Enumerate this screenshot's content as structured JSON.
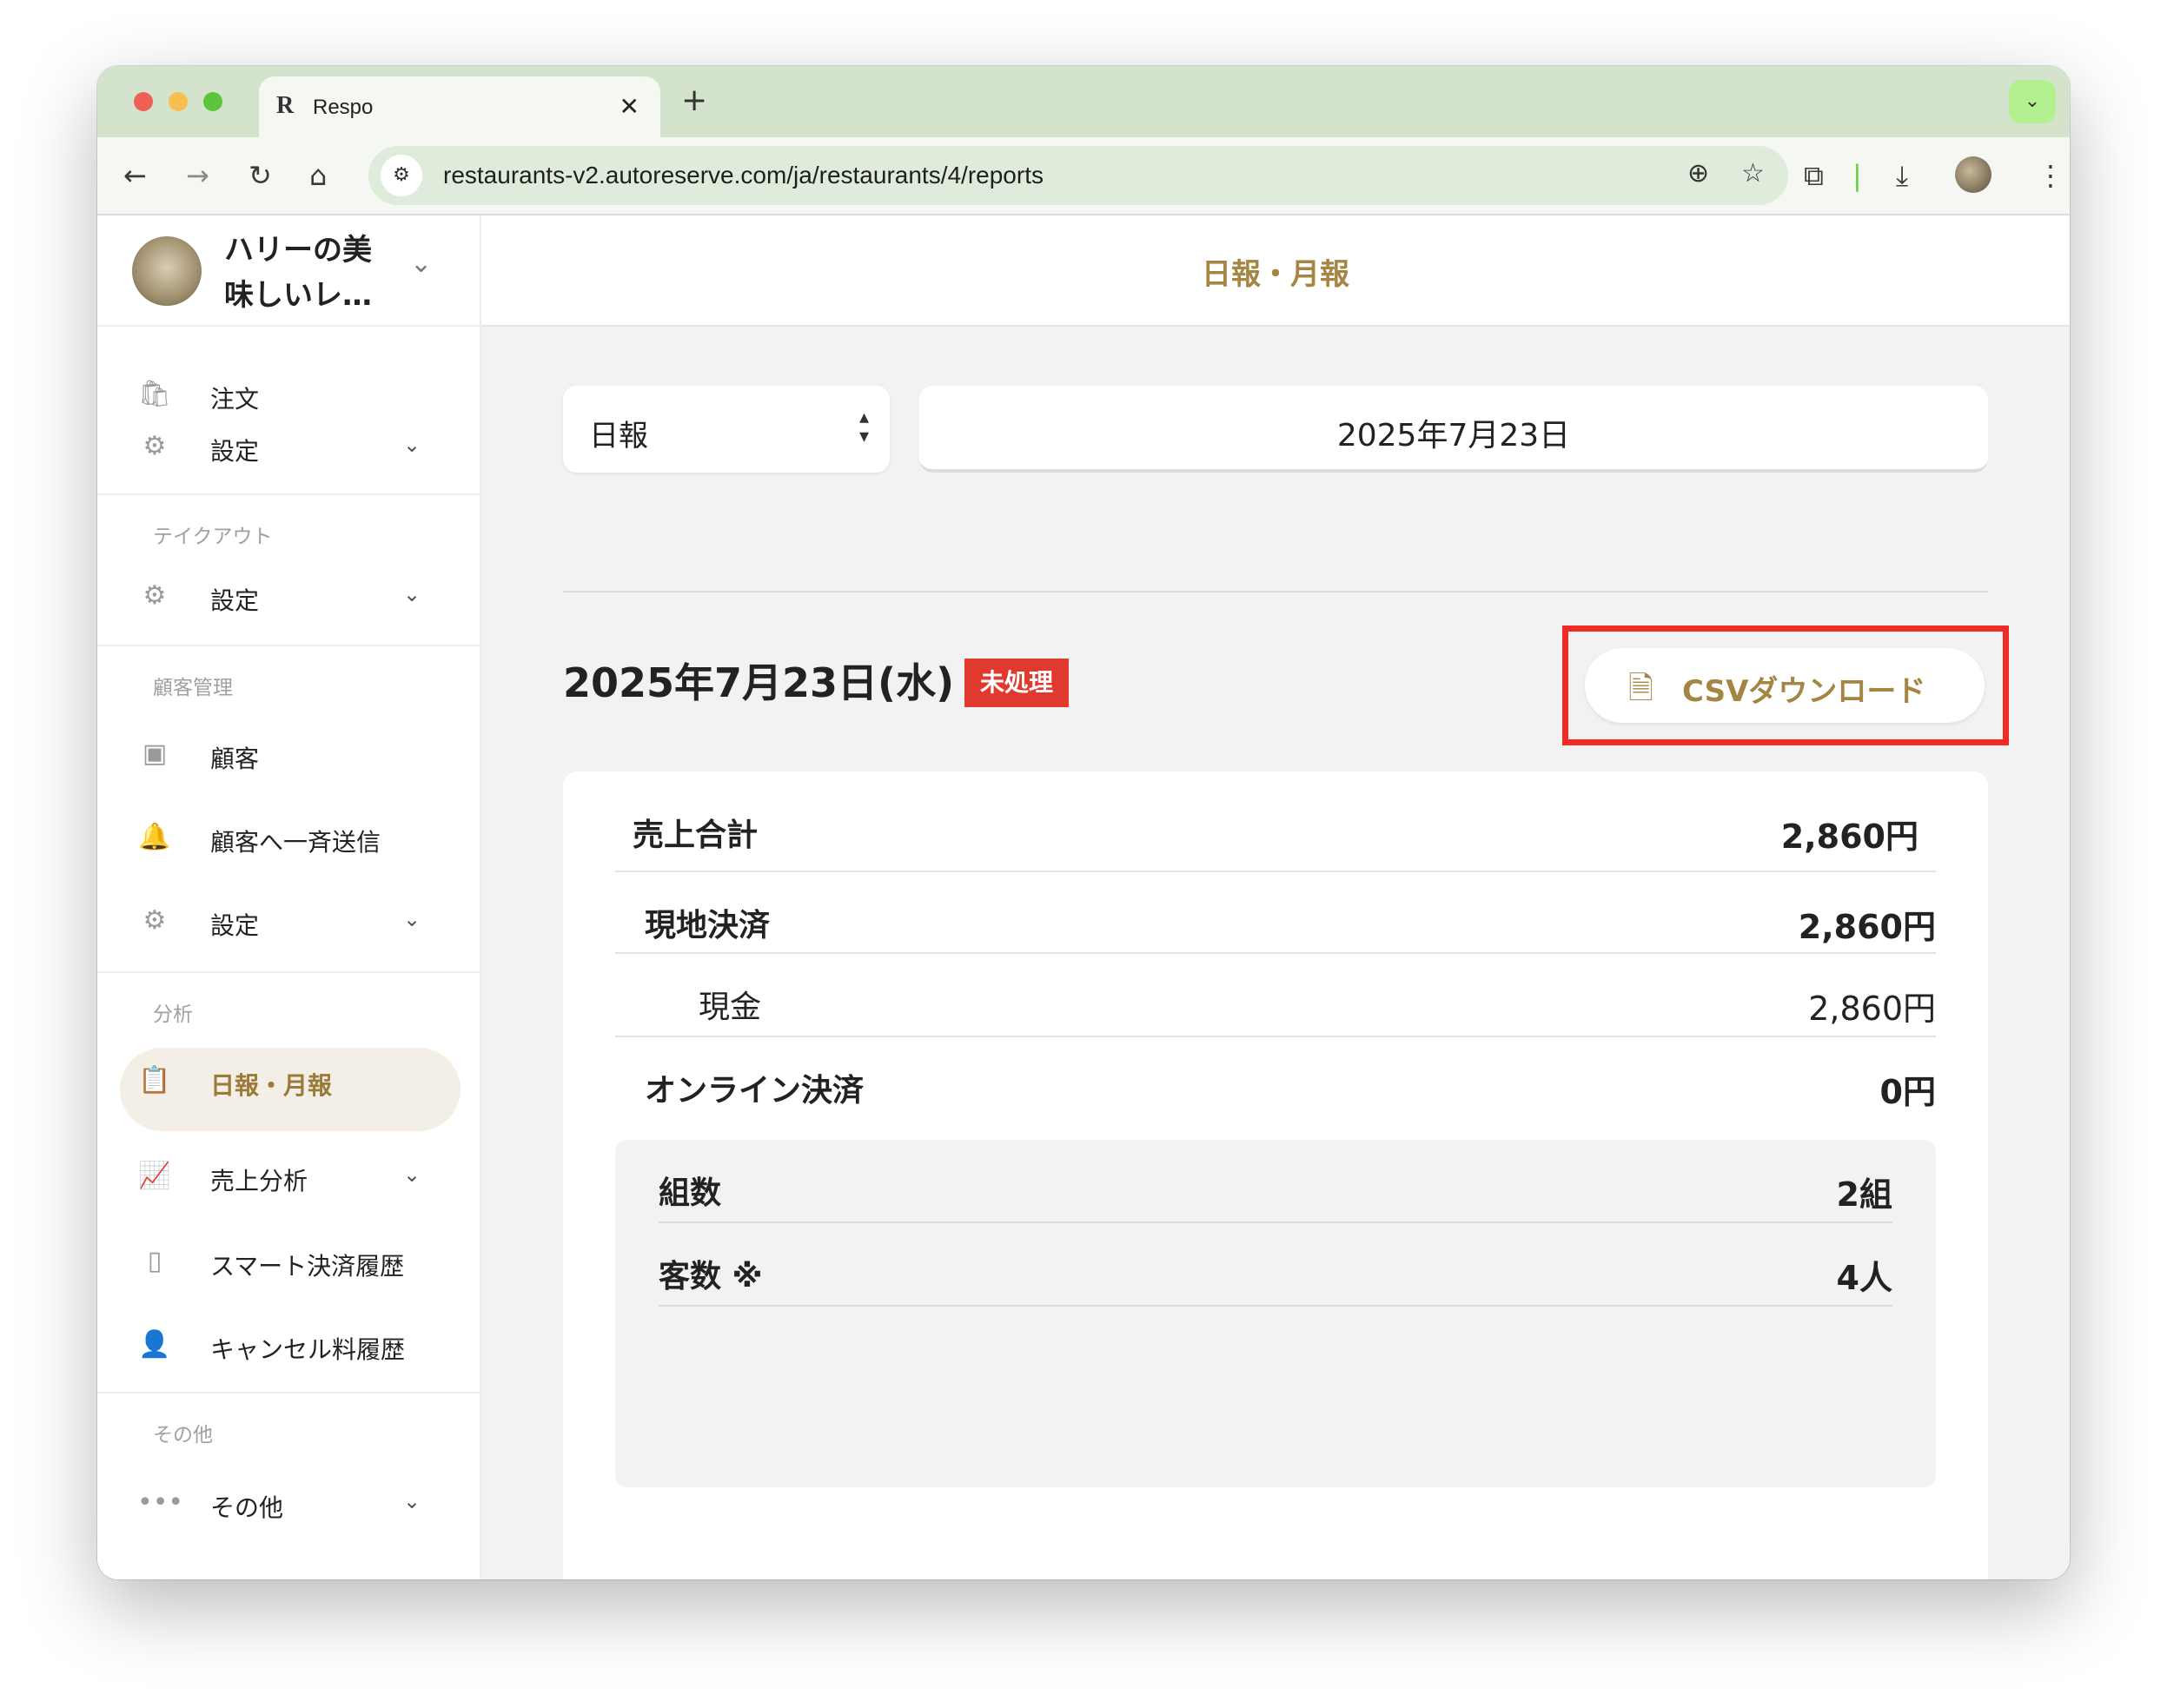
{
  "browser": {
    "tab_title": "Respo",
    "tab_logo": "R",
    "url": "restaurants-v2.autoreserve.com/ja/restaurants/4/reports"
  },
  "sidebar": {
    "shop_name": "ハリーの美味しいレ…",
    "items": {
      "order": "注文",
      "settings_1": "設定",
      "section_takeout": "テイクアウト",
      "settings_2": "設定",
      "section_customers": "顧客管理",
      "customers": "顧客",
      "broadcast": "顧客へ一斉送信",
      "settings_3": "設定",
      "section_analysis": "分析",
      "daily_monthly": "日報・月報",
      "sales_analysis": "売上分析",
      "smart_payment_history": "スマート決済履歴",
      "cancel_fee_history": "キャンセル料履歴",
      "section_other": "その他",
      "other": "その他"
    }
  },
  "main": {
    "page_title": "日報・月報",
    "report_type": "日報",
    "date_picker": "2025年7月23日",
    "report_date": "2025年7月23日(水)",
    "status_badge": "未処理",
    "csv_button": "CSVダウンロード",
    "rows": {
      "total_sales_label": "売上合計",
      "total_sales_value": "2,860円",
      "onsite_label": "現地決済",
      "onsite_value": "2,860円",
      "cash_label": "現金",
      "cash_value": "2,860円",
      "online_label": "オンライン決済",
      "online_value": "0円",
      "groups_label": "組数",
      "groups_value": "2組",
      "guests_label": "客数 ※",
      "guests_value": "4人"
    }
  },
  "colors": {
    "accent": "#a48544",
    "badge": "#e03a2e",
    "highlight": "#ee2b24",
    "tabbar": "#d3e3cc"
  }
}
